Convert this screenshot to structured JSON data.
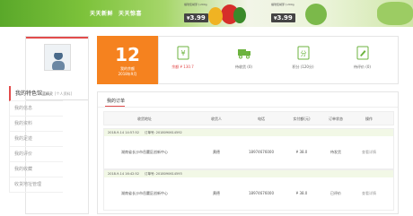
{
  "banner": {
    "slogan": [
      "天天新鲜",
      "天天惊喜"
    ],
    "promos": [
      {
        "text": "福瑞佳胡萝卜200g",
        "currency": "¥",
        "price": "3.99"
      },
      {
        "text": "福瑞佳胡萝卜200g",
        "currency": "¥",
        "price": "3.99"
      }
    ]
  },
  "sidebar": {
    "username": "蓝精灵",
    "level": "[个人资料]",
    "menu_title": "我的特色馆",
    "items": [
      "我的信息",
      "我的资料",
      "我的足迹",
      "我的评价",
      "我的收藏",
      "收货地址管理"
    ]
  },
  "balance": {
    "value": "12",
    "label": "我的余额",
    "date": "2018年9月"
  },
  "stats": [
    {
      "icon": "balance-icon",
      "label": "余额 ¥ 130.7",
      "highlight": true
    },
    {
      "icon": "truck-icon",
      "label": "待收货 (0)",
      "highlight": false
    },
    {
      "icon": "points-icon",
      "label": "积分 (120分)",
      "highlight": false
    },
    {
      "icon": "pencil-icon",
      "label": "待评价 (0)",
      "highlight": false
    }
  ],
  "orders": {
    "title": "我的订单",
    "columns": [
      "收货地址",
      "收货人",
      "电话",
      "实付额(元)",
      "订单状态",
      "操作"
    ],
    "groups": [
      {
        "date": "2018-9-14 14:57:52",
        "order_label": "订单号: ",
        "order_no": "2018090614592",
        "address": "湖南省长沙市岳麓区创新中心",
        "receiver": "黄德",
        "phone": "18974676000",
        "amount": "¥ 38.0",
        "status": "待发货",
        "action": "查看详情"
      },
      {
        "date": "2018-9-14 16:42:52",
        "order_label": "订单号: ",
        "order_no": "2018090614593",
        "address": "湖南省长沙市岳麓区创新中心",
        "receiver": "黄德",
        "phone": "18974676000",
        "amount": "¥ 38.0",
        "status": "已评价",
        "action": "查看详情"
      }
    ]
  },
  "colors": {
    "accent": "#e24b4b",
    "orange": "#f5821f",
    "green": "#6cb33f"
  }
}
